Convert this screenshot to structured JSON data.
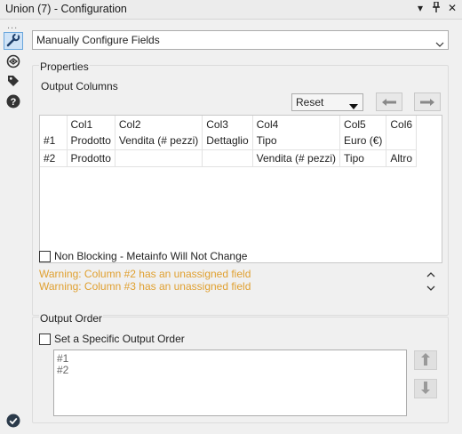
{
  "titlebar": {
    "title": "Union (7) - Configuration",
    "icons": [
      "dropdown-icon",
      "pin-icon",
      "close-icon"
    ],
    "dropdown_glyph": "▾",
    "pin_glyph": "⊥",
    "close_glyph": "✕"
  },
  "sidebar": {
    "overflow": "...",
    "items": [
      {
        "icon": "wrench-icon",
        "active": true
      },
      {
        "icon": "connections-icon",
        "active": false
      },
      {
        "icon": "tag-icon",
        "active": false
      },
      {
        "icon": "help-icon",
        "active": false
      }
    ],
    "status_icon": "check-circle-icon"
  },
  "config_mode": {
    "value": "Manually Configure Fields"
  },
  "properties": {
    "label": "Properties",
    "output_columns_label": "Output Columns",
    "reset_combo": {
      "value": "Reset"
    },
    "move_left_icon": "arrow-left-icon",
    "move_right_icon": "arrow-right-icon",
    "table": {
      "columns": [
        "Col1",
        "Col2",
        "Col3",
        "Col4",
        "Col5",
        "Col6"
      ],
      "rows": [
        {
          "header": "#1",
          "cells": [
            "Prodotto",
            "Vendita (# pezzi)",
            "Dettaglio",
            "Tipo",
            "Euro (€)",
            ""
          ]
        },
        {
          "header": "#2",
          "cells": [
            "Prodotto",
            "",
            "",
            "Vendita (# pezzi)",
            "Tipo",
            "Altro"
          ]
        }
      ]
    },
    "non_blocking": {
      "label": "Non Blocking - Metainfo Will Not Change",
      "checked": false
    },
    "warnings": [
      "Warning: Column #2 has an unassigned field",
      "Warning: Column #3 has an unassigned field"
    ]
  },
  "output_order": {
    "label": "Output Order",
    "specific_order": {
      "label": "Set a Specific Output Order",
      "checked": false
    },
    "items": [
      "#1",
      "#2"
    ]
  },
  "colors": {
    "warning": "#e0a030",
    "accent": "#6aa6dc",
    "success": "#2e7d32"
  }
}
